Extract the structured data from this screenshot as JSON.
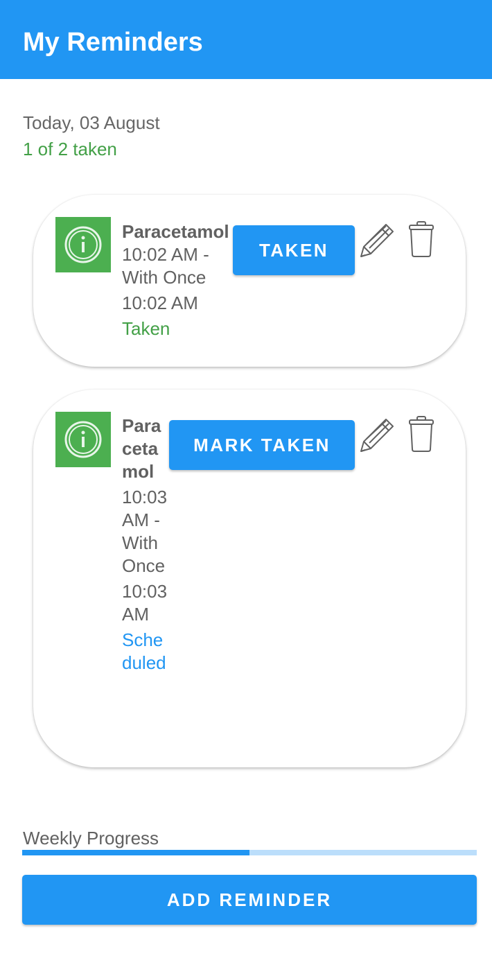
{
  "app": {
    "title": "My Reminders"
  },
  "summary": {
    "date": "Today, 03 August",
    "taken_count": "1 of 2 taken"
  },
  "reminders": [
    {
      "icon": "info-icon",
      "name": "Paracetamol",
      "schedule": "10:02 AM - With Once",
      "time": "10:02 AM",
      "status": "Taken",
      "button_label": "TAKEN"
    },
    {
      "icon": "info-icon",
      "name": "Paracetamol",
      "schedule": "10:03 AM - With Once",
      "time": "10:03 AM",
      "status": "Scheduled",
      "button_label": "MARK TAKEN"
    }
  ],
  "progress": {
    "label": "Weekly Progress",
    "value": 0.5
  },
  "actions": {
    "add_label": "ADD REMINDER"
  },
  "colors": {
    "primary": "#2196f3",
    "success": "#43a047",
    "icon_tile": "#4caf50"
  }
}
